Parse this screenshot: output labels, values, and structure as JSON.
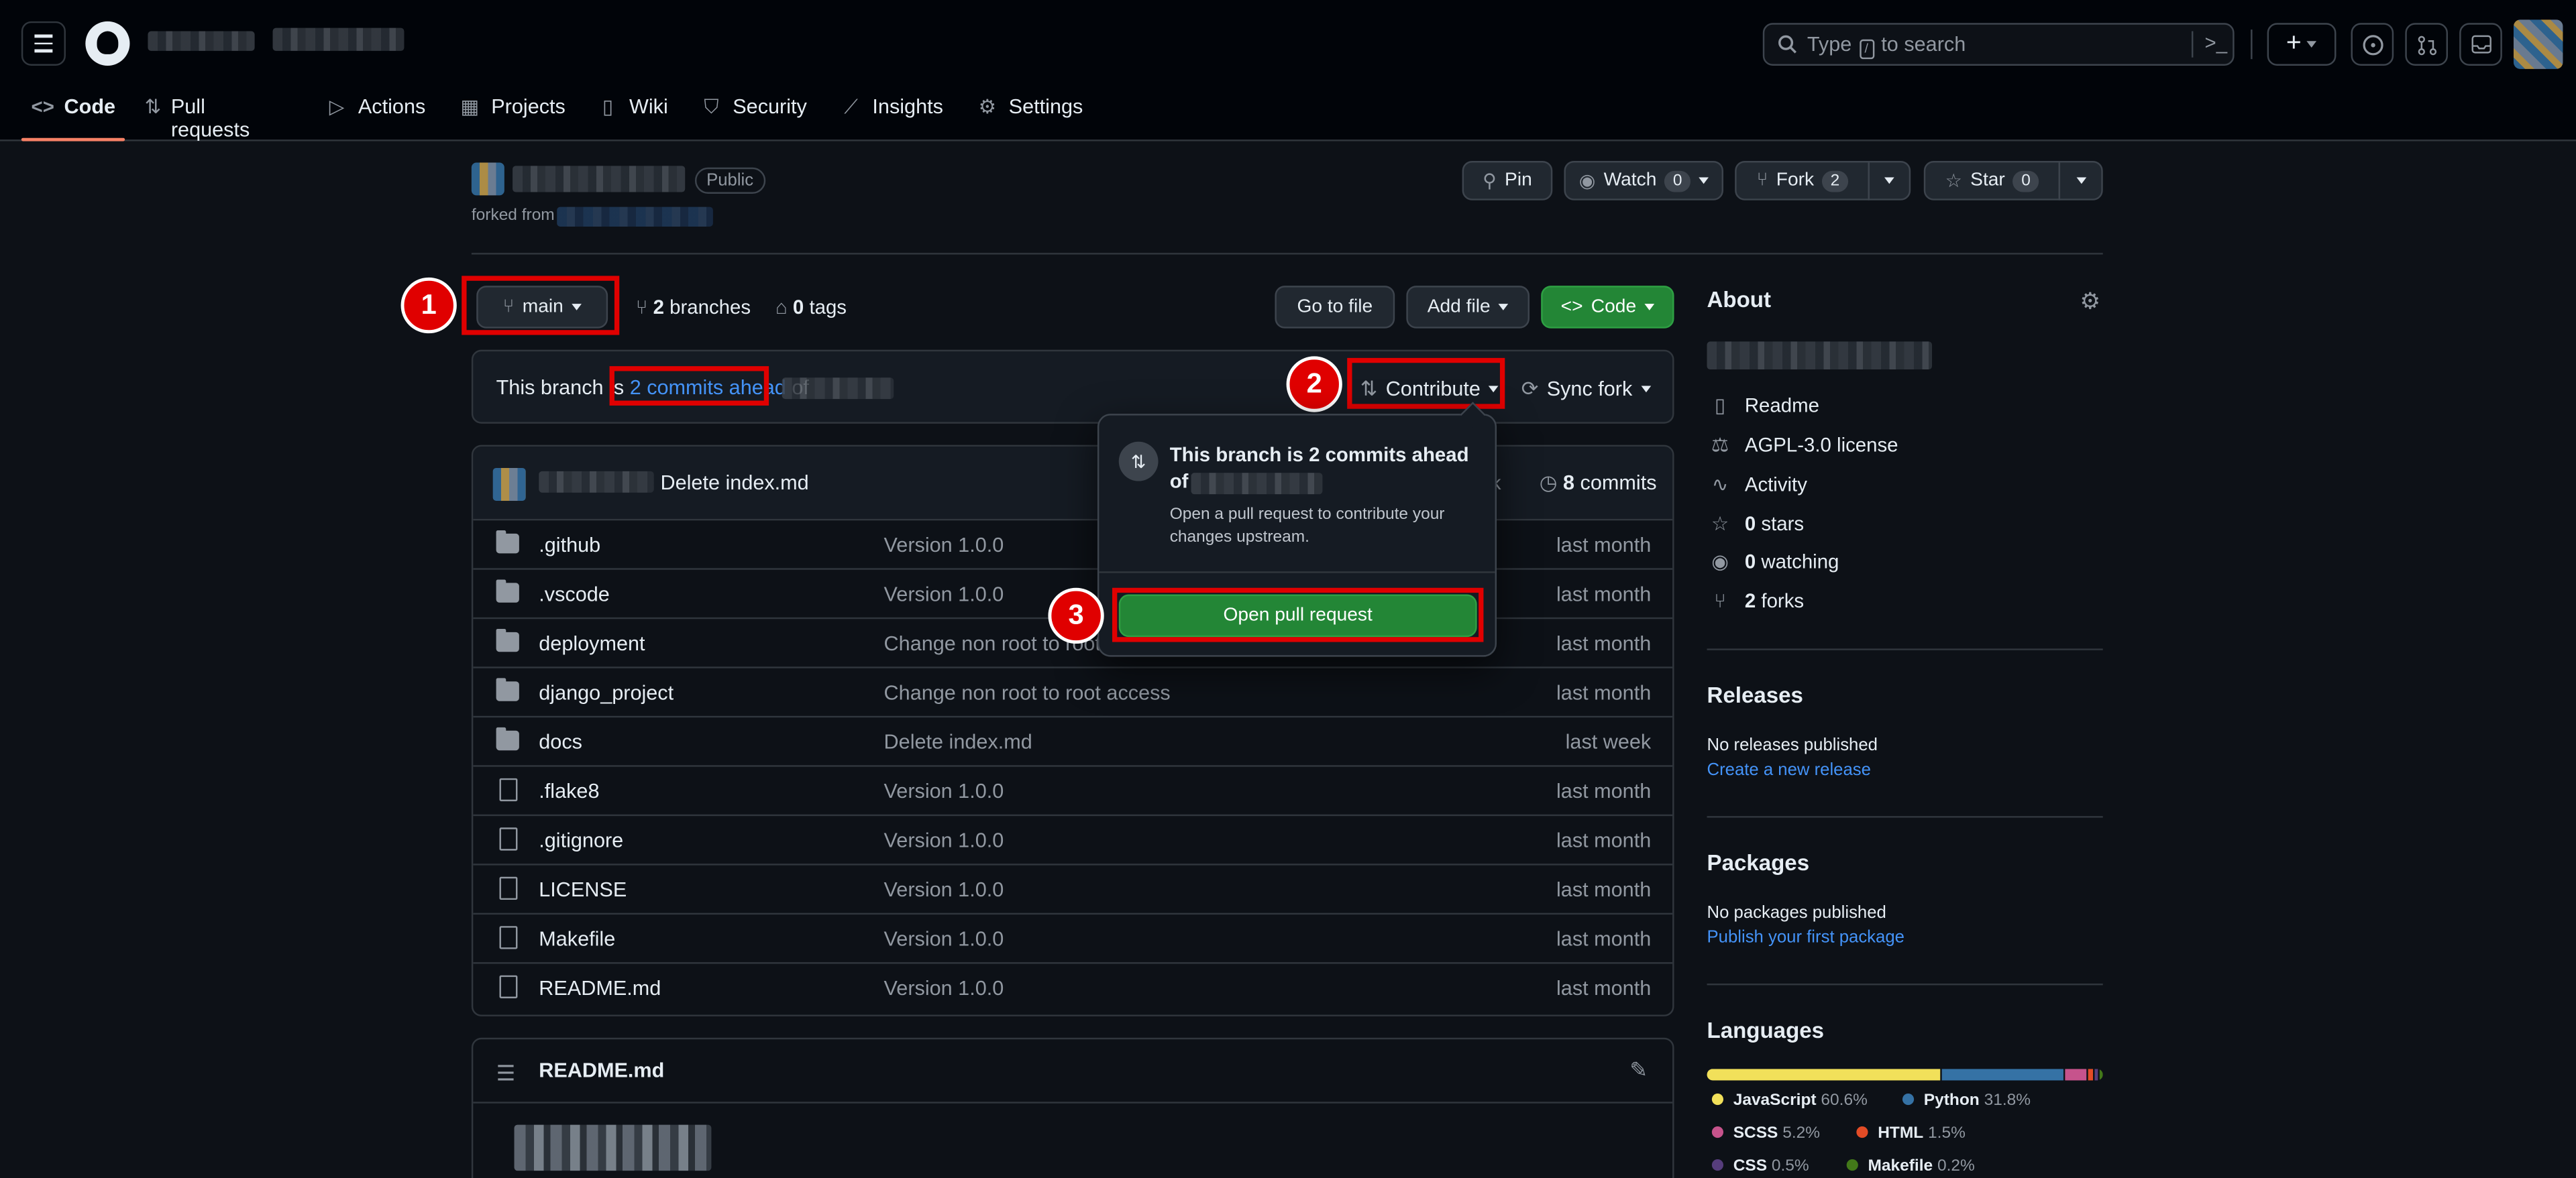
{
  "header": {
    "search_placeholder_before": "Type",
    "search_placeholder_key": "/",
    "search_placeholder_after": "to search",
    "tabs": [
      {
        "label": "Code",
        "icon": "code-icon"
      },
      {
        "label": "Pull requests",
        "icon": "git-pull-request-icon"
      },
      {
        "label": "Actions",
        "icon": "play-icon"
      },
      {
        "label": "Projects",
        "icon": "table-icon"
      },
      {
        "label": "Wiki",
        "icon": "book-icon"
      },
      {
        "label": "Security",
        "icon": "shield-icon"
      },
      {
        "label": "Insights",
        "icon": "graph-icon"
      },
      {
        "label": "Settings",
        "icon": "gear-icon"
      }
    ]
  },
  "repo": {
    "visibility": "Public",
    "forked_from_label": "forked from",
    "pin_label": "Pin",
    "watch_label": "Watch",
    "watch_count": "0",
    "fork_label": "Fork",
    "fork_count": "2",
    "star_label": "Star",
    "star_count": "0"
  },
  "toolbar": {
    "branch": "main",
    "branches_count": "2",
    "branches_label": "branches",
    "tags_count": "0",
    "tags_label": "tags",
    "go_to_file": "Go to file",
    "add_file": "Add file",
    "code": "Code"
  },
  "branch_status": {
    "prefix": "This branch is",
    "link": "2 commits ahead",
    "suffix": "of",
    "contribute": "Contribute",
    "sync_fork": "Sync fork"
  },
  "popover": {
    "title_line1": "This branch is 2 commits ahead",
    "title_line2": "of",
    "desc_line1": "Open a pull request to contribute your",
    "desc_line2": "changes upstream.",
    "button": "Open pull request"
  },
  "commit_bar": {
    "message": "Delete index.md",
    "time_partial": "ek",
    "commits_count": "8",
    "commits_label": "commits"
  },
  "files": [
    {
      "name": ".github",
      "type": "dir",
      "message": "Version 1.0.0",
      "date": "last month"
    },
    {
      "name": ".vscode",
      "type": "dir",
      "message": "Version 1.0.0",
      "date": "last month"
    },
    {
      "name": "deployment",
      "type": "dir",
      "message": "Change non root to root a",
      "date": "last month"
    },
    {
      "name": "django_project",
      "type": "dir",
      "message": "Change non root to root access",
      "date": "last month"
    },
    {
      "name": "docs",
      "type": "dir",
      "message": "Delete index.md",
      "date": "last week"
    },
    {
      "name": ".flake8",
      "type": "file",
      "message": "Version 1.0.0",
      "date": "last month"
    },
    {
      "name": ".gitignore",
      "type": "file",
      "message": "Version 1.0.0",
      "date": "last month"
    },
    {
      "name": "LICENSE",
      "type": "file",
      "message": "Version 1.0.0",
      "date": "last month"
    },
    {
      "name": "Makefile",
      "type": "file",
      "message": "Version 1.0.0",
      "date": "last month"
    },
    {
      "name": "README.md",
      "type": "file",
      "message": "Version 1.0.0",
      "date": "last month"
    }
  ],
  "readme": {
    "title": "README.md"
  },
  "about": {
    "title": "About",
    "readme": "Readme",
    "license": "AGPL-3.0 license",
    "activity": "Activity",
    "stars_count": "0",
    "stars_label": "stars",
    "watching_count": "0",
    "watching_label": "watching",
    "forks_count": "2",
    "forks_label": "forks"
  },
  "releases": {
    "title": "Releases",
    "empty": "No releases published",
    "link": "Create a new release"
  },
  "packages": {
    "title": "Packages",
    "empty": "No packages published",
    "link": "Publish your first package"
  },
  "languages": {
    "title": "Languages",
    "items": [
      {
        "name": "JavaScript",
        "percent": "60.6%",
        "value": 60.6,
        "color": "#f1e05a"
      },
      {
        "name": "Python",
        "percent": "31.8%",
        "value": 31.8,
        "color": "#3572A5"
      },
      {
        "name": "SCSS",
        "percent": "5.2%",
        "value": 5.2,
        "color": "#c6538c"
      },
      {
        "name": "HTML",
        "percent": "1.5%",
        "value": 1.5,
        "color": "#e34c26"
      },
      {
        "name": "CSS",
        "percent": "0.5%",
        "value": 0.5,
        "color": "#563d7c"
      },
      {
        "name": "Makefile",
        "percent": "0.2%",
        "value": 0.2,
        "color": "#427819"
      }
    ]
  },
  "annotations": {
    "step1": "1",
    "step2": "2",
    "step3": "3"
  }
}
